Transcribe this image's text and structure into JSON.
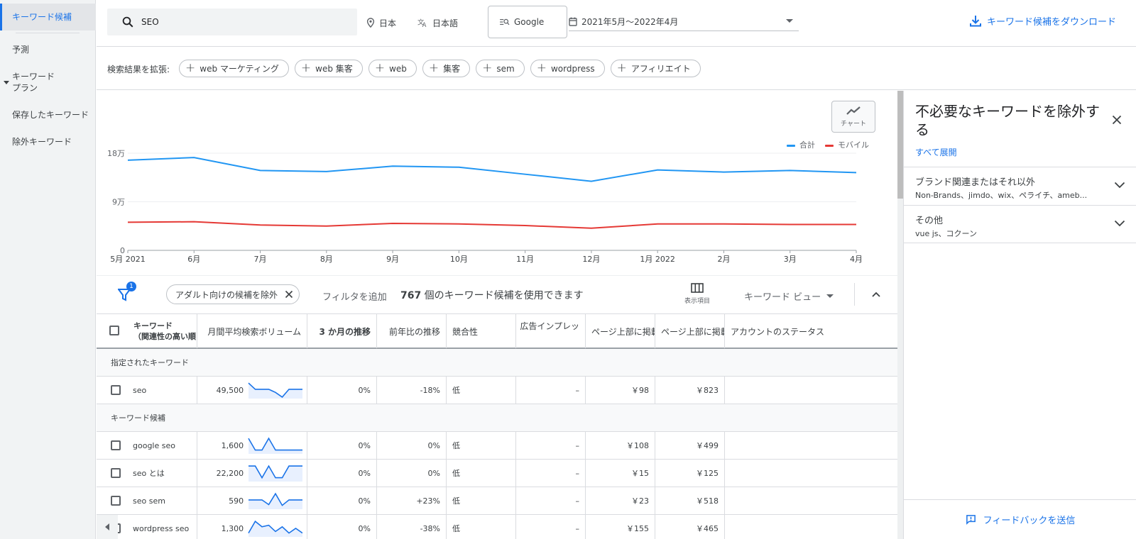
{
  "sidebar": {
    "items": [
      {
        "label": "キーワード候補"
      },
      {
        "label": "予測"
      },
      {
        "label": "キーワード\nプラン"
      },
      {
        "label": "保存したキーワード"
      },
      {
        "label": "除外キーワード"
      }
    ]
  },
  "topbar": {
    "search_value": "SEO",
    "location": "日本",
    "language": "日本語",
    "network": "Google",
    "date_range": "2021年5月～2022年4月",
    "download_label": "キーワード候補をダウンロード"
  },
  "expand": {
    "label": "検索結果を拡張:",
    "chips": [
      "web マーケティング",
      "web 集客",
      "web",
      "集客",
      "sem",
      "wordpress",
      "アフィリエイト"
    ]
  },
  "chart_toggle_label": "チャート",
  "chart_data": {
    "type": "line",
    "categories": [
      "5月 2021",
      "6月",
      "7月",
      "8月",
      "9月",
      "10月",
      "11月",
      "12月",
      "1月 2022",
      "2月",
      "3月",
      "4月"
    ],
    "series": [
      {
        "name": "合計",
        "color": "#2196f3",
        "values": [
          167000,
          172000,
          148000,
          146000,
          156000,
          154000,
          141000,
          128000,
          149000,
          145000,
          148000,
          144000
        ]
      },
      {
        "name": "モバイル",
        "color": "#e53935",
        "values": [
          52000,
          53000,
          47000,
          45000,
          50000,
          49000,
          46000,
          41000,
          49000,
          49000,
          48000,
          48000
        ]
      }
    ],
    "yticks": [
      "0",
      "9万",
      "18万"
    ],
    "ylim": [
      0,
      180000
    ],
    "legend_position": "top-right",
    "grid": true
  },
  "filterbar": {
    "badge": "1",
    "filter_chip": "アダルト向けの候補を除外",
    "add_filter": "フィルタを追加",
    "count_num": "767",
    "count_text": " 個のキーワード候補を使用できます",
    "columns_label": "表示項目",
    "view_label": "キーワード ビュー"
  },
  "table": {
    "headers": {
      "keyword_line1": "キーワード",
      "keyword_line2": "（関連性の高い順",
      "volume": "月間平均検索ボリューム",
      "three_month": "3 か月の推移",
      "yoy": "前年比の推移",
      "competition": "競合性",
      "ad_impr": "広告インプレッ",
      "top_low": "ページ上部に掲載",
      "top_high": "ページ上部に掲載",
      "account_status": "アカウントのステータス"
    },
    "group_specified": "指定されたキーワード",
    "group_ideas": "キーワード候補",
    "specified_rows": [
      {
        "keyword": "seo",
        "volume": "49,500",
        "trend": [
          0.95,
          0.55,
          0.55,
          0.55,
          0.35,
          0.05,
          0.55,
          0.55,
          0.55
        ],
        "three_month": "0%",
        "yoy": "-18%",
        "competition": "低",
        "ad_impr": "–",
        "top_low": "￥98",
        "top_high": "￥823"
      }
    ],
    "idea_rows": [
      {
        "keyword": "google seo",
        "volume": "1,600",
        "trend": [
          0.95,
          0.2,
          0.2,
          0.95,
          0.2,
          0.2,
          0.2,
          0.2,
          0.2
        ],
        "three_month": "0%",
        "yoy": "0%",
        "competition": "低",
        "ad_impr": "–",
        "top_low": "￥108",
        "top_high": "￥499"
      },
      {
        "keyword": "seo とは",
        "volume": "22,200",
        "trend": [
          0.95,
          0.95,
          0.2,
          0.95,
          0.2,
          0.2,
          0.95,
          0.95,
          0.95
        ],
        "three_month": "0%",
        "yoy": "0%",
        "competition": "低",
        "ad_impr": "–",
        "top_low": "￥15",
        "top_high": "￥125"
      },
      {
        "keyword": "seo sem",
        "volume": "590",
        "trend": [
          0.55,
          0.55,
          0.55,
          0.25,
          0.95,
          0.2,
          0.55,
          0.55,
          0.55
        ],
        "three_month": "0%",
        "yoy": "+23%",
        "competition": "低",
        "ad_impr": "–",
        "top_low": "￥23",
        "top_high": "￥518"
      },
      {
        "keyword": "wordpress seo",
        "volume": "1,300",
        "trend": [
          0.2,
          0.95,
          0.6,
          0.7,
          0.3,
          0.6,
          0.2,
          0.5,
          0.2
        ],
        "three_month": "0%",
        "yoy": "-38%",
        "competition": "低",
        "ad_impr": "–",
        "top_low": "￥155",
        "top_high": "￥465"
      }
    ]
  },
  "right_panel": {
    "title": "不必要なキーワードを除外する",
    "expand_all": "すべて展開",
    "sections": [
      {
        "title": "ブランド関連またはそれ以外",
        "subtitle": "Non-Brands、jimdo、wix、ペライチ、ameb..."
      },
      {
        "title": "その他",
        "subtitle": "vue js、コクーン"
      }
    ],
    "feedback": "フィードバックを送信"
  }
}
